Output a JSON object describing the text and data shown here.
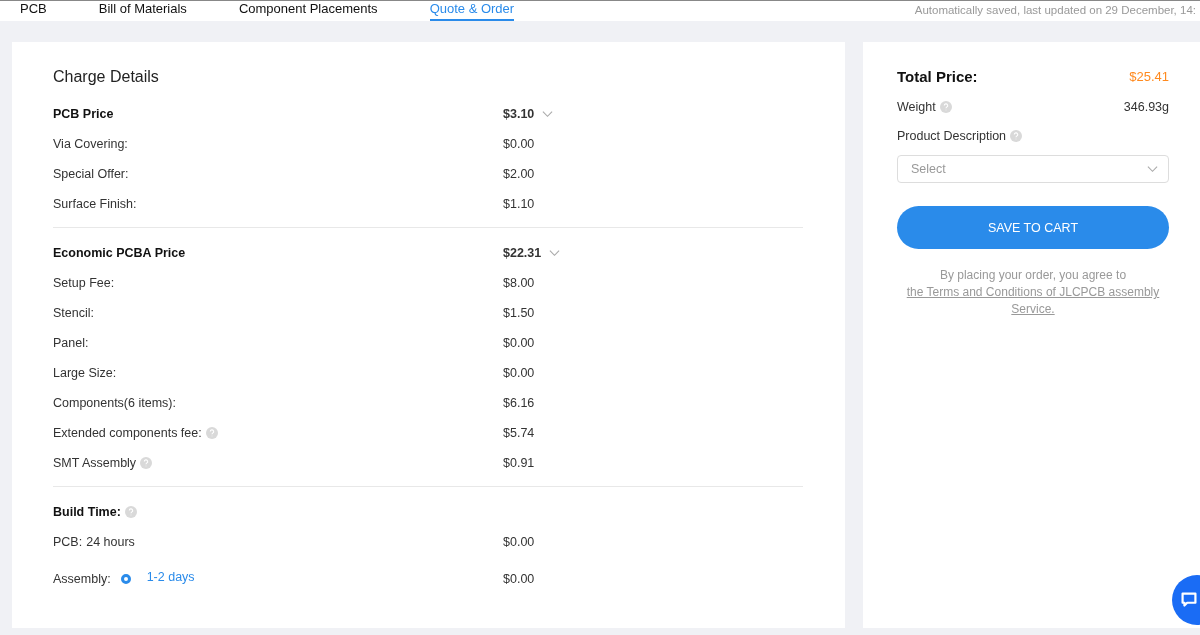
{
  "tabs": [
    {
      "label": "PCB",
      "selected": false
    },
    {
      "label": "Bill of Materials",
      "selected": false
    },
    {
      "label": "Component Placements",
      "selected": false
    },
    {
      "label": "Quote & Order",
      "selected": true
    }
  ],
  "autosave_note": "Automatically saved, last updated on 29 December, 14:",
  "charge_details": {
    "title": "Charge Details",
    "groups": [
      {
        "label": "PCB Price",
        "value": "$3.10",
        "expanded": true,
        "items": [
          {
            "label": "Via Covering:",
            "value": "$0.00",
            "help": false
          },
          {
            "label": "Special Offer:",
            "value": "$2.00",
            "help": false
          },
          {
            "label": "Surface Finish:",
            "value": "$1.10",
            "help": false
          }
        ]
      },
      {
        "label": "Economic PCBA Price",
        "value": "$22.31",
        "expanded": true,
        "items": [
          {
            "label": "Setup Fee:",
            "value": "$8.00",
            "help": false
          },
          {
            "label": "Stencil:",
            "value": "$1.50",
            "help": false
          },
          {
            "label": "Panel:",
            "value": "$0.00",
            "help": false
          },
          {
            "label": "Large Size:",
            "value": "$0.00",
            "help": false
          },
          {
            "label": "Components(6 items):",
            "value": "$6.16",
            "help": false
          },
          {
            "label": "Extended components fee:",
            "value": "$5.74",
            "help": true
          },
          {
            "label": "SMT Assembly",
            "value": "$0.91",
            "help": true
          }
        ]
      }
    ],
    "build_time": {
      "label": "Build Time:",
      "rows": [
        {
          "kind": "text",
          "label": "PCB:",
          "option": "24 hours",
          "value": "$0.00"
        },
        {
          "kind": "radio",
          "label": "Assembly:",
          "option": "1-2 days",
          "selected": true,
          "value": "$0.00"
        }
      ]
    }
  },
  "summary": {
    "total_label": "Total Price:",
    "total_value": "$25.41",
    "weight_label": "Weight",
    "weight_value": "346.93g",
    "description_label": "Product Description",
    "description_placeholder": "Select",
    "button": "SAVE TO CART",
    "agreement": "By placing your order, you agree to ",
    "agreement_link": "the Terms and Conditions of JLCPCB assembly Service."
  }
}
